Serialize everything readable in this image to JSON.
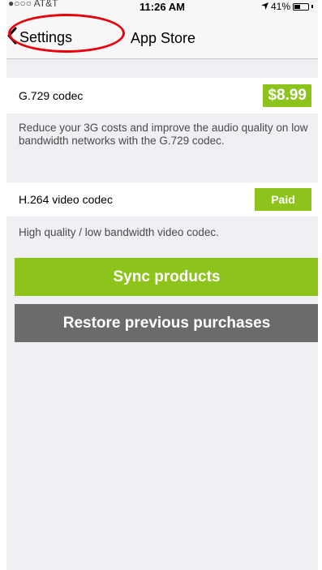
{
  "status_bar": {
    "carrier": "●○○○ AT&T",
    "time": "11:26 AM",
    "battery_percent": "41%",
    "battery_level": 0.41
  },
  "nav": {
    "back_label": "Settings",
    "title": "App Store"
  },
  "products": [
    {
      "name": "G.729 codec",
      "action_label": "$8.99",
      "description": "Reduce your 3G costs and improve the audio quality on low bandwidth networks with the G.729 codec."
    },
    {
      "name": "H.264 video codec",
      "action_label": "Paid",
      "description": "High quality / low bandwidth video codec."
    }
  ],
  "buttons": {
    "sync": "Sync products",
    "restore": "Restore previous purchases"
  },
  "colors": {
    "accent_green": "#8dc41c",
    "restore_gray": "#6b6b69",
    "annotation_red": "#e8000b"
  }
}
